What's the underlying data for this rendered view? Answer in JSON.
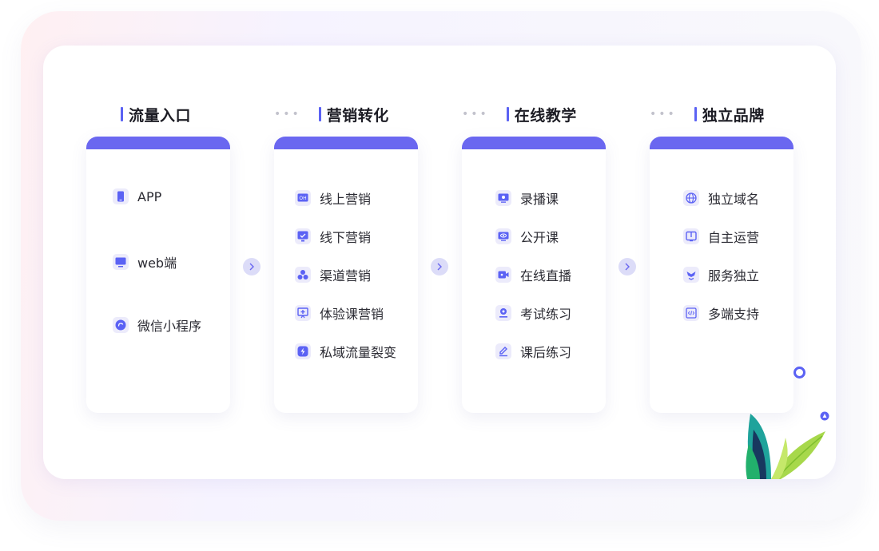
{
  "columns": [
    {
      "title": "流量入口",
      "items": [
        {
          "label": "APP",
          "icon": "phone-icon"
        },
        {
          "label": "web端",
          "icon": "monitor-icon"
        },
        {
          "label": "微信小程序",
          "icon": "mini-program-icon"
        }
      ]
    },
    {
      "title": "营销转化",
      "items": [
        {
          "label": "线上营销",
          "icon": "online-marketing-icon"
        },
        {
          "label": "线下营销",
          "icon": "offline-marketing-icon"
        },
        {
          "label": "渠道营销",
          "icon": "channel-icon"
        },
        {
          "label": "体验课营销",
          "icon": "trial-class-icon"
        },
        {
          "label": "私域流量裂变",
          "icon": "lightning-icon"
        }
      ]
    },
    {
      "title": "在线教学",
      "items": [
        {
          "label": "录播课",
          "icon": "recorded-class-icon"
        },
        {
          "label": "公开课",
          "icon": "open-class-icon"
        },
        {
          "label": "在线直播",
          "icon": "live-video-icon"
        },
        {
          "label": "考试练习",
          "icon": "exam-icon"
        },
        {
          "label": "课后练习",
          "icon": "pencil-icon"
        }
      ]
    },
    {
      "title": "独立品牌",
      "items": [
        {
          "label": "独立域名",
          "icon": "globe-icon"
        },
        {
          "label": "自主运营",
          "icon": "book-icon"
        },
        {
          "label": "服务独立",
          "icon": "service-icon"
        },
        {
          "label": "多端支持",
          "icon": "code-icon"
        }
      ]
    }
  ],
  "colors": {
    "accent": "#5b62f4",
    "card_header": "#6a67f0",
    "icon_bg": "#ecebfb",
    "text": "#2b2b33",
    "title": "#1c1c24"
  }
}
